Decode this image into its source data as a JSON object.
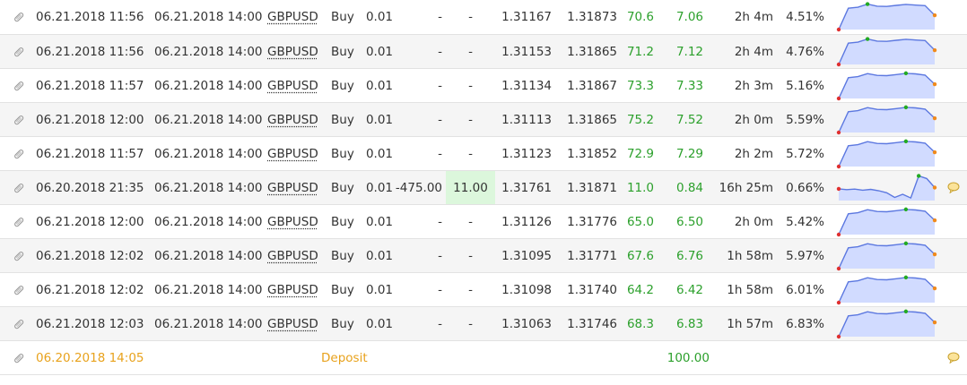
{
  "trades": [
    {
      "open": "06.21.2018 11:56",
      "close": "06.21.2018 14:00",
      "symbol": "GBPUSD",
      "action": "Buy",
      "lots": "0.01",
      "sl": "-",
      "tp": "-",
      "open_price": "1.31167",
      "close_price": "1.31873",
      "pips": "70.6",
      "profit": "7.06",
      "duration": "2h 4m",
      "gain": "4.51%",
      "spark": [
        0.0,
        0.82,
        0.86,
        0.98,
        0.9,
        0.89,
        0.93,
        0.97,
        0.94,
        0.92,
        0.55
      ]
    },
    {
      "open": "06.21.2018 11:56",
      "close": "06.21.2018 14:00",
      "symbol": "GBPUSD",
      "action": "Buy",
      "lots": "0.01",
      "sl": "-",
      "tp": "-",
      "open_price": "1.31153",
      "close_price": "1.31865",
      "pips": "71.2",
      "profit": "7.12",
      "duration": "2h 4m",
      "gain": "4.76%",
      "spark": [
        0.0,
        0.82,
        0.86,
        0.98,
        0.9,
        0.89,
        0.93,
        0.97,
        0.94,
        0.92,
        0.55
      ]
    },
    {
      "open": "06.21.2018 11:57",
      "close": "06.21.2018 14:00",
      "symbol": "GBPUSD",
      "action": "Buy",
      "lots": "0.01",
      "sl": "-",
      "tp": "-",
      "open_price": "1.31134",
      "close_price": "1.31867",
      "pips": "73.3",
      "profit": "7.33",
      "duration": "2h 3m",
      "gain": "5.16%",
      "spark": [
        0.0,
        0.8,
        0.84,
        0.96,
        0.89,
        0.88,
        0.92,
        0.97,
        0.95,
        0.9,
        0.55
      ]
    },
    {
      "open": "06.21.2018 12:00",
      "close": "06.21.2018 14:00",
      "symbol": "GBPUSD",
      "action": "Buy",
      "lots": "0.01",
      "sl": "-",
      "tp": "-",
      "open_price": "1.31113",
      "close_price": "1.31865",
      "pips": "75.2",
      "profit": "7.52",
      "duration": "2h 0m",
      "gain": "5.59%",
      "spark": [
        0.0,
        0.8,
        0.84,
        0.96,
        0.89,
        0.88,
        0.92,
        0.97,
        0.95,
        0.9,
        0.55
      ]
    },
    {
      "open": "06.21.2018 11:57",
      "close": "06.21.2018 14:00",
      "symbol": "GBPUSD",
      "action": "Buy",
      "lots": "0.01",
      "sl": "-",
      "tp": "-",
      "open_price": "1.31123",
      "close_price": "1.31852",
      "pips": "72.9",
      "profit": "7.29",
      "duration": "2h 2m",
      "gain": "5.72%",
      "spark": [
        0.0,
        0.8,
        0.84,
        0.96,
        0.89,
        0.88,
        0.92,
        0.97,
        0.95,
        0.9,
        0.55
      ]
    },
    {
      "open": "06.20.2018 21:35",
      "close": "06.21.2018 14:00",
      "symbol": "GBPUSD",
      "action": "Buy",
      "lots": "0.01",
      "sl": "-475.00",
      "tp": "11.00",
      "open_price": "1.31761",
      "close_price": "1.31871",
      "pips": "11.0",
      "profit": "0.84",
      "duration": "16h 25m",
      "gain": "0.66%",
      "spark": [
        0.45,
        0.42,
        0.44,
        0.4,
        0.43,
        0.38,
        0.3,
        0.12,
        0.24,
        0.1,
        0.95,
        0.85,
        0.5
      ],
      "comment": true
    },
    {
      "open": "06.21.2018 12:00",
      "close": "06.21.2018 14:00",
      "symbol": "GBPUSD",
      "action": "Buy",
      "lots": "0.01",
      "sl": "-",
      "tp": "-",
      "open_price": "1.31126",
      "close_price": "1.31776",
      "pips": "65.0",
      "profit": "6.50",
      "duration": "2h 0m",
      "gain": "5.42%",
      "spark": [
        0.0,
        0.8,
        0.84,
        0.96,
        0.89,
        0.88,
        0.92,
        0.97,
        0.95,
        0.9,
        0.55
      ]
    },
    {
      "open": "06.21.2018 12:02",
      "close": "06.21.2018 14:00",
      "symbol": "GBPUSD",
      "action": "Buy",
      "lots": "0.01",
      "sl": "-",
      "tp": "-",
      "open_price": "1.31095",
      "close_price": "1.31771",
      "pips": "67.6",
      "profit": "6.76",
      "duration": "1h 58m",
      "gain": "5.97%",
      "spark": [
        0.0,
        0.8,
        0.84,
        0.96,
        0.89,
        0.88,
        0.92,
        0.97,
        0.95,
        0.9,
        0.55
      ]
    },
    {
      "open": "06.21.2018 12:02",
      "close": "06.21.2018 14:00",
      "symbol": "GBPUSD",
      "action": "Buy",
      "lots": "0.01",
      "sl": "-",
      "tp": "-",
      "open_price": "1.31098",
      "close_price": "1.31740",
      "pips": "64.2",
      "profit": "6.42",
      "duration": "1h 58m",
      "gain": "6.01%",
      "spark": [
        0.0,
        0.8,
        0.84,
        0.96,
        0.89,
        0.88,
        0.92,
        0.97,
        0.95,
        0.9,
        0.55
      ]
    },
    {
      "open": "06.21.2018 12:03",
      "close": "06.21.2018 14:00",
      "symbol": "GBPUSD",
      "action": "Buy",
      "lots": "0.01",
      "sl": "-",
      "tp": "-",
      "open_price": "1.31063",
      "close_price": "1.31746",
      "pips": "68.3",
      "profit": "6.83",
      "duration": "1h 57m",
      "gain": "6.83%",
      "spark": [
        0.0,
        0.8,
        0.84,
        0.96,
        0.89,
        0.88,
        0.92,
        0.97,
        0.95,
        0.9,
        0.55
      ]
    }
  ],
  "deposit": {
    "open": "06.20.2018 14:05",
    "type": "Deposit",
    "amount": "100.00",
    "comment": true
  },
  "colors": {
    "profit_green": "#2ca02c",
    "deposit_orange": "#e8a21c",
    "tp_highlight": "#dcf7dc",
    "spark_line": "#5c78e0",
    "spark_fill": "#d1dbff",
    "spark_start": "#e03030",
    "spark_peak": "#22aa22",
    "spark_end": "#f08a1c"
  },
  "icons": {
    "row": "paperclip-icon",
    "comment": "comment-bubble-icon"
  }
}
